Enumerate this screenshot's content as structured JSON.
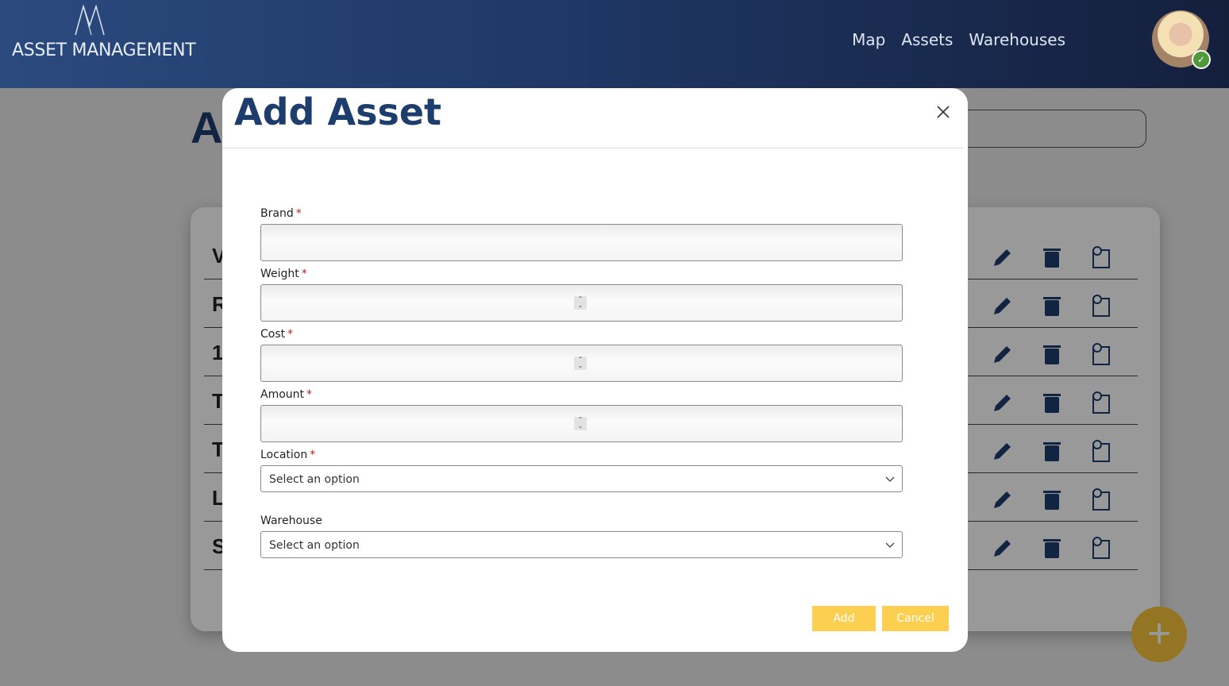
{
  "header": {
    "logo_text": "ASSET MANAGEMENT",
    "nav": [
      "Map",
      "Assets",
      "Warehouses"
    ],
    "background_color": "#1f3866"
  },
  "page": {
    "title_partial": "A",
    "row_initials": [
      "V",
      "R",
      "1",
      "T",
      "T",
      "L",
      "S"
    ]
  },
  "modal": {
    "title": "Add Asset",
    "fields": {
      "brand": {
        "label": "Brand",
        "required": "*",
        "value": ""
      },
      "weight": {
        "label": "Weight",
        "required": "*",
        "value": ""
      },
      "cost": {
        "label": "Cost",
        "required": "*",
        "value": ""
      },
      "amount": {
        "label": "Amount",
        "required": "*",
        "value": ""
      },
      "location": {
        "label": "Location",
        "required": "*",
        "selected": "Select an option"
      },
      "warehouse": {
        "label": "Warehouse",
        "selected": "Select an option"
      }
    },
    "buttons": {
      "add": "Add",
      "cancel": "Cancel"
    }
  },
  "colors": {
    "accent_yellow": "#fdcf50",
    "brand_blue": "#1d3d6d",
    "required_red": "#b3261e"
  }
}
